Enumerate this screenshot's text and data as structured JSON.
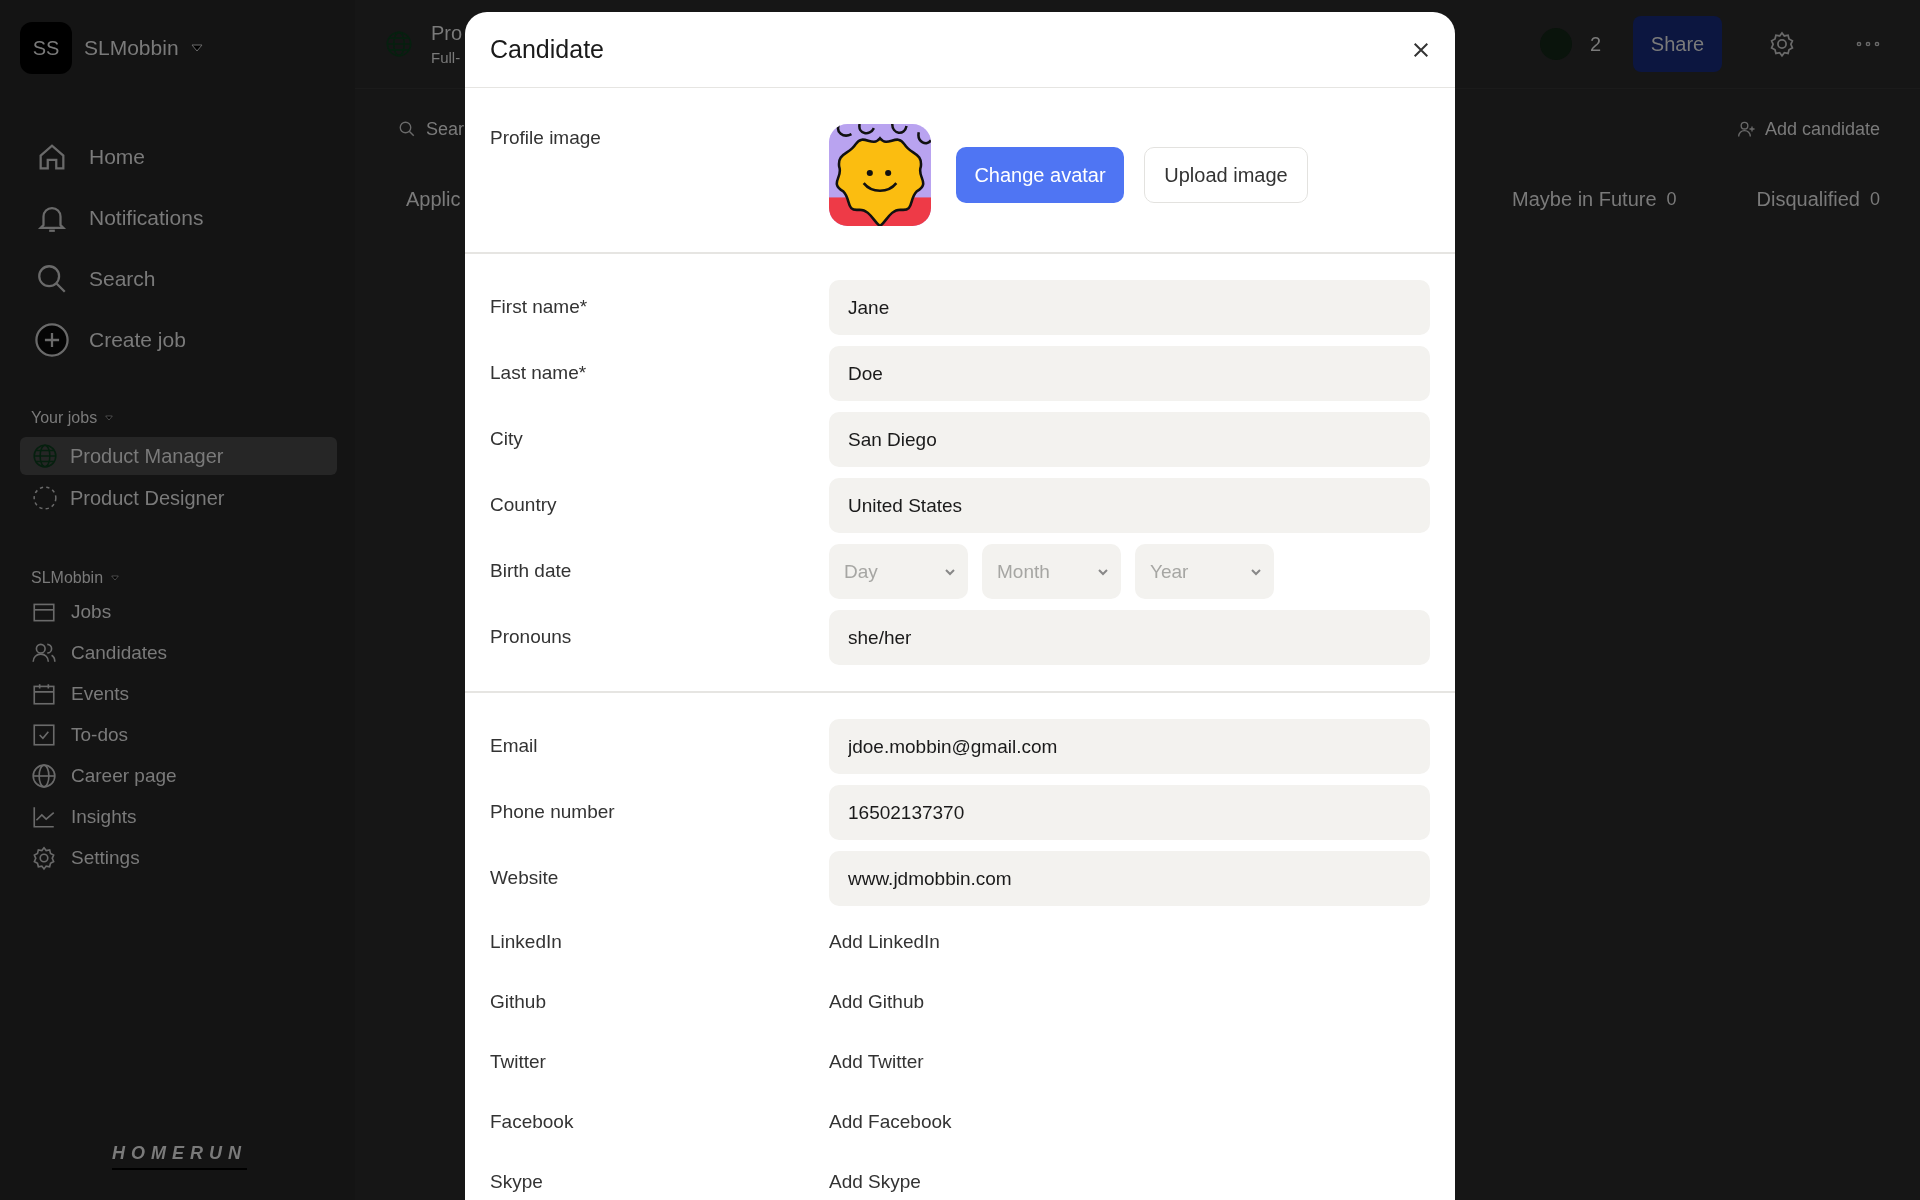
{
  "workspace": {
    "initials": "SS",
    "name": "SLMobbin"
  },
  "nav": [
    {
      "label": "Home",
      "kind": "home"
    },
    {
      "label": "Notifications",
      "kind": "bell"
    },
    {
      "label": "Search",
      "kind": "search"
    },
    {
      "label": "Create job",
      "kind": "plus"
    }
  ],
  "your_jobs": {
    "heading": "Your jobs",
    "items": [
      {
        "label": "Product Manager",
        "kind": "public",
        "selected": true
      },
      {
        "label": "Product Designer",
        "kind": "draft",
        "selected": false
      }
    ]
  },
  "org_menu": {
    "heading": "SLMobbin",
    "items": [
      {
        "label": "Jobs",
        "kind": "jobs"
      },
      {
        "label": "Candidates",
        "kind": "people"
      },
      {
        "label": "Events",
        "kind": "calendar"
      },
      {
        "label": "To-dos",
        "kind": "todo"
      },
      {
        "label": "Career page",
        "kind": "globe"
      },
      {
        "label": "Insights",
        "kind": "chart"
      },
      {
        "label": "Settings",
        "kind": "gear"
      }
    ]
  },
  "brand": "HOMERUN",
  "job_header": {
    "title": "Pro",
    "subtitle": "Full-",
    "viewers": "2",
    "share": "Share"
  },
  "toolbar": {
    "search": "Sear",
    "add_candidate": "Add candidate"
  },
  "stages": [
    {
      "label": "Applic"
    },
    {
      "label": "Maybe in Future",
      "count": "0"
    },
    {
      "label": "Disqualified",
      "count": "0"
    }
  ],
  "modal": {
    "title": "Candidate",
    "profile": {
      "label": "Profile image",
      "change": "Change avatar",
      "upload": "Upload image"
    },
    "sections": [
      [
        {
          "label": "First name*",
          "kind": "text",
          "value": "Jane"
        },
        {
          "label": "Last name*",
          "kind": "text",
          "value": "Doe"
        },
        {
          "label": "City",
          "kind": "text",
          "value": "San Diego"
        },
        {
          "label": "Country",
          "kind": "text",
          "value": "United States"
        },
        {
          "label": "Birth date",
          "kind": "date",
          "parts": [
            "Day",
            "Month",
            "Year"
          ]
        },
        {
          "label": "Pronouns",
          "kind": "text",
          "value": "she/her"
        }
      ],
      [
        {
          "label": "Email",
          "kind": "text",
          "value": "jdoe.mobbin@gmail.com"
        },
        {
          "label": "Phone number",
          "kind": "text",
          "value": "16502137370"
        },
        {
          "label": "Website",
          "kind": "text",
          "value": "www.jdmobbin.com"
        },
        {
          "label": "LinkedIn",
          "kind": "link",
          "value": "Add LinkedIn"
        },
        {
          "label": "Github",
          "kind": "link",
          "value": "Add Github"
        },
        {
          "label": "Twitter",
          "kind": "link",
          "value": "Add Twitter"
        },
        {
          "label": "Facebook",
          "kind": "link",
          "value": "Add Facebook"
        },
        {
          "label": "Skype",
          "kind": "link",
          "value": "Add Skype"
        }
      ]
    ]
  }
}
